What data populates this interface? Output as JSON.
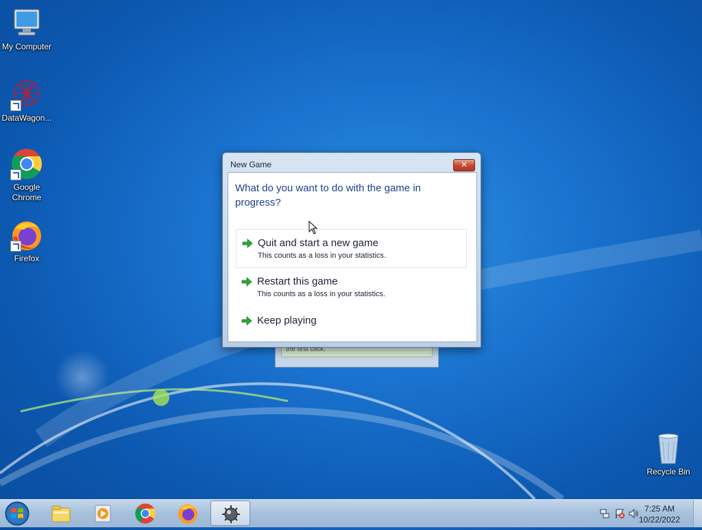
{
  "desktop": {
    "icons": [
      {
        "label": "My Computer",
        "icon": "computer-icon"
      },
      {
        "label": "DataWagon...",
        "icon": "datawagon-icon"
      },
      {
        "label": "Google Chrome",
        "icon": "chrome-icon"
      },
      {
        "label": "Firefox",
        "icon": "firefox-icon"
      },
      {
        "label": "Recycle Bin",
        "icon": "recycle-bin-icon"
      }
    ]
  },
  "background_window": {
    "partial_text": "the first click."
  },
  "dialog": {
    "title": "New Game",
    "close_label": "✕",
    "question": "What do you want to do with the game in progress?",
    "options": [
      {
        "label": "Quit and start a new game",
        "sub": "This counts as a loss in your statistics.",
        "icon": "green-arrow-icon"
      },
      {
        "label": "Restart this game",
        "sub": "This counts as a loss in your statistics.",
        "icon": "green-arrow-icon"
      },
      {
        "label": "Keep playing",
        "sub": "",
        "icon": "green-arrow-icon"
      }
    ]
  },
  "taskbar": {
    "start": "windows-start-icon",
    "pinned": [
      {
        "name": "file-explorer-icon"
      },
      {
        "name": "media-player-icon"
      },
      {
        "name": "chrome-icon"
      },
      {
        "name": "firefox-icon"
      },
      {
        "name": "minesweeper-icon",
        "active": true
      }
    ],
    "tray": {
      "icons": [
        "network-icon",
        "action-center-flag-icon",
        "volume-icon"
      ],
      "time": "7:25 AM",
      "date": "10/22/2022"
    }
  },
  "colors": {
    "desktop_blue": "#1a73cf",
    "dialog_question": "#1f3e8e",
    "arrow_green": "#2fa836",
    "close_red": "#c2452d"
  }
}
